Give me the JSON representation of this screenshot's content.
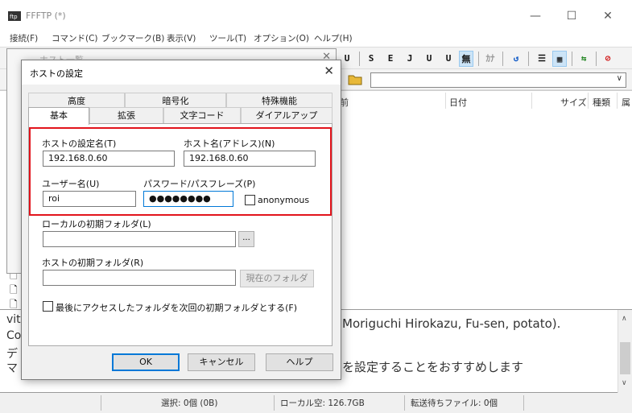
{
  "window": {
    "title": "FFFTP (*)",
    "minimize_glyph": "—",
    "maximize_glyph": "☐",
    "close_glyph": "✕"
  },
  "menu": [
    {
      "label": "接続(F)"
    },
    {
      "label": "コマンド(C)"
    },
    {
      "label": "ブックマーク(B)"
    },
    {
      "label": "表示(V)"
    },
    {
      "label": "ツール(T)"
    },
    {
      "label": "オプション(O)"
    },
    {
      "label": "ヘルプ(H)"
    }
  ],
  "toolbar": {
    "buttons": [
      {
        "label": "U",
        "name": "upload-sync"
      },
      {
        "label": "S",
        "name": "sjis"
      },
      {
        "label": "E",
        "name": "euc"
      },
      {
        "label": "J",
        "name": "jis"
      },
      {
        "label": "U",
        "name": "utf8"
      },
      {
        "label": "U",
        "name": "utf8-bom"
      },
      {
        "label": "無",
        "name": "no-convert"
      },
      {
        "label": "ｶﾅ",
        "name": "kana"
      },
      {
        "label": "↺",
        "name": "refresh"
      },
      {
        "label": "☰",
        "name": "list-view"
      },
      {
        "label": "▦",
        "name": "detail-view"
      },
      {
        "label": "⇆",
        "name": "sync"
      },
      {
        "label": "⊘",
        "name": "stop"
      }
    ]
  },
  "host_list": {
    "title": "ホスト一覧",
    "close_glyph": "✕"
  },
  "file_list": {
    "columns": [
      {
        "label": "前"
      },
      {
        "label": "日付"
      },
      {
        "label": "サイズ"
      },
      {
        "label": "種類"
      },
      {
        "label": "属"
      }
    ]
  },
  "log": {
    "lines": [
      {
        "left": "vita",
        "right": "Moriguchi Hirokazu, Fu-sen, potato)."
      },
      {
        "left": "Co",
        "right": ""
      },
      {
        "left": "デ",
        "right": ""
      },
      {
        "left": "マ",
        "right": "を設定することをおすすめします"
      }
    ]
  },
  "status": {
    "selected": "選択: 0個 (0B)",
    "local_free": "ローカル空: 126.7GB",
    "queue": "転送待ちファイル: 0個"
  },
  "dialog": {
    "title": "ホストの設定",
    "close_glyph": "✕",
    "tabs_back": [
      {
        "label": "高度"
      },
      {
        "label": "暗号化"
      },
      {
        "label": "特殊機能"
      }
    ],
    "tabs_front": [
      {
        "label": "基本"
      },
      {
        "label": "拡張"
      },
      {
        "label": "文字コード"
      },
      {
        "label": "ダイアルアップ"
      }
    ],
    "fields": {
      "host_setting_name_label": "ホストの設定名(T)",
      "host_setting_name_value": "192.168.0.60",
      "host_name_label": "ホスト名(アドレス)(N)",
      "host_name_value": "192.168.0.60",
      "user_name_label": "ユーザー名(U)",
      "user_name_value": "roi",
      "password_label": "パスワード/パスフレーズ(P)",
      "password_value": "●●●●●●●●",
      "anonymous_label": "anonymous",
      "local_folder_label": "ローカルの初期フォルダ(L)",
      "local_folder_value": "",
      "browse_label": "...",
      "host_folder_label": "ホストの初期フォルダ(R)",
      "host_folder_value": "",
      "current_folder_label": "現在のフォルダ",
      "last_folder_label": "最後にアクセスしたフォルダを次回の初期フォルダとする(F)"
    },
    "buttons": {
      "ok": "OK",
      "cancel": "キャンセル",
      "help": "ヘルプ"
    },
    "highlight_color": "#e2141c"
  }
}
